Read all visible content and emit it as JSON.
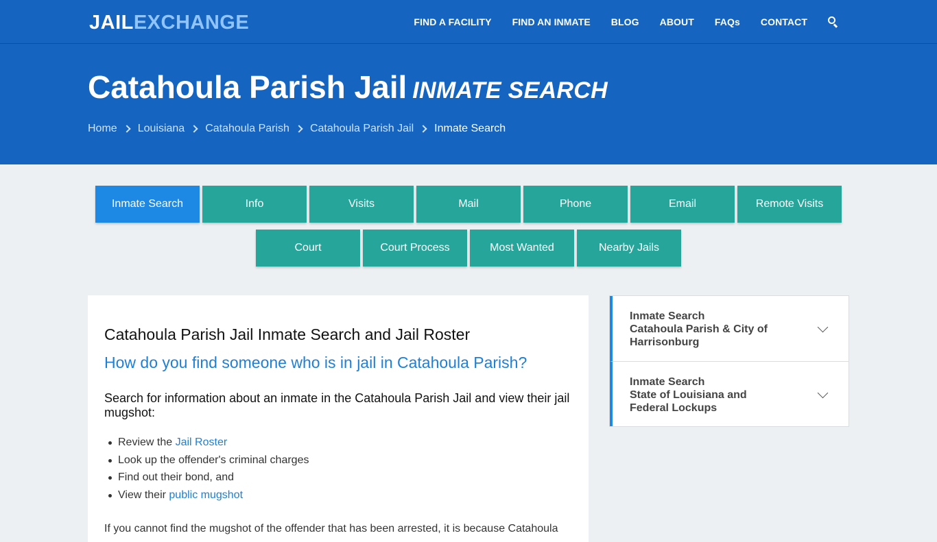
{
  "logo": {
    "part1": "JAIL",
    "part2": "EXCHANGE"
  },
  "nav": {
    "items": [
      "FIND A FACILITY",
      "FIND AN INMATE",
      "BLOG",
      "ABOUT",
      "FAQs",
      "CONTACT"
    ]
  },
  "hero": {
    "title": "Catahoula Parish Jail",
    "subtitle": "INMATE SEARCH",
    "breadcrumbs": [
      "Home",
      "Louisiana",
      "Catahoula Parish",
      "Catahoula Parish Jail"
    ],
    "current": "Inmate Search"
  },
  "tabs": {
    "row1": [
      "Inmate Search",
      "Info",
      "Visits",
      "Mail",
      "Phone",
      "Email",
      "Remote Visits"
    ],
    "row2": [
      "Court",
      "Court Process",
      "Most Wanted",
      "Nearby Jails"
    ],
    "active": "Inmate Search"
  },
  "content": {
    "heading": "Catahoula Parish Jail Inmate Search and Jail Roster",
    "question": "How do you find someone who is in jail in Catahoula Parish?",
    "intro": "Search for information about an inmate in the Catahoula Parish Jail and view their jail mugshot:",
    "bullets": [
      {
        "pre": "Review the ",
        "link": "Jail Roster",
        "post": ""
      },
      {
        "pre": "Look up the offender's criminal charges",
        "link": "",
        "post": ""
      },
      {
        "pre": "Find out their bond, and",
        "link": "",
        "post": ""
      },
      {
        "pre": "View their ",
        "link": "public mugshot",
        "post": ""
      }
    ],
    "paragraph": "If you cannot find the mugshot of the offender that has been arrested, it is because Catahoula"
  },
  "sidebar": {
    "items": [
      {
        "title": "Inmate Search",
        "subtitle": "Catahoula Parish & City of Harrisonburg"
      },
      {
        "title": "Inmate Search",
        "subtitle": "State of Louisiana and Federal Lockups"
      }
    ]
  },
  "colors": {
    "header_blue": "#1565c0",
    "tab_teal": "#26a69a",
    "tab_active": "#1e88e5",
    "link_blue": "#1e7fd6"
  }
}
